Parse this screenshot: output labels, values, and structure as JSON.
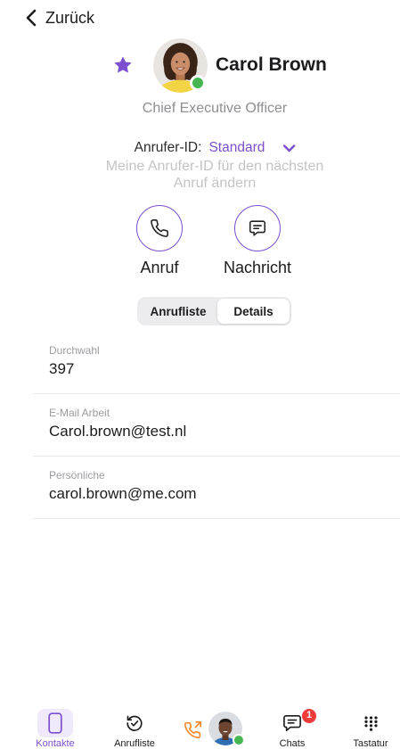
{
  "header": {
    "back_label": "Zurück",
    "back_icon": "chevron-left-icon"
  },
  "contact": {
    "name": "Carol Brown",
    "title": "Chief Executive Officer",
    "favorite": true,
    "favorite_icon": "star-icon",
    "online": true
  },
  "caller_id": {
    "label": "Anrufer-ID:",
    "value": "Standard",
    "dropdown_icon": "chevron-down-icon",
    "hint": "Meine Anrufer-ID für den nächsten Anruf ändern"
  },
  "actions": {
    "call": {
      "label": "Anruf",
      "icon": "phone-icon"
    },
    "message": {
      "label": "Nachricht",
      "icon": "message-icon"
    }
  },
  "segments": {
    "items": [
      "Anrufliste",
      "Details"
    ],
    "selected_index": 1
  },
  "details": [
    {
      "label": "Durchwahl",
      "value": "397"
    },
    {
      "label": "E-Mail Arbeit",
      "value": "Carol.brown@test.nl"
    },
    {
      "label": "Persönliche",
      "value": "carol.brown@me.com"
    }
  ],
  "tabbar": {
    "contacts": {
      "label": "Kontakte",
      "icon": "contacts-book-icon",
      "active": true
    },
    "calls": {
      "label": "Anrufliste",
      "icon": "call-history-icon",
      "active": false
    },
    "call_status": {
      "icon": "phone-outgoing-icon",
      "online": true
    },
    "chats": {
      "label": "Chats",
      "icon": "chat-bubble-icon",
      "badge": "1",
      "active": false
    },
    "keypad": {
      "label": "Tastatur",
      "icon": "keypad-icon",
      "active": false
    }
  },
  "colors": {
    "accent": "#7b4fcf",
    "online": "#46b653",
    "badge": "#ee3b3b",
    "call_indicator": "#f08a2c"
  }
}
